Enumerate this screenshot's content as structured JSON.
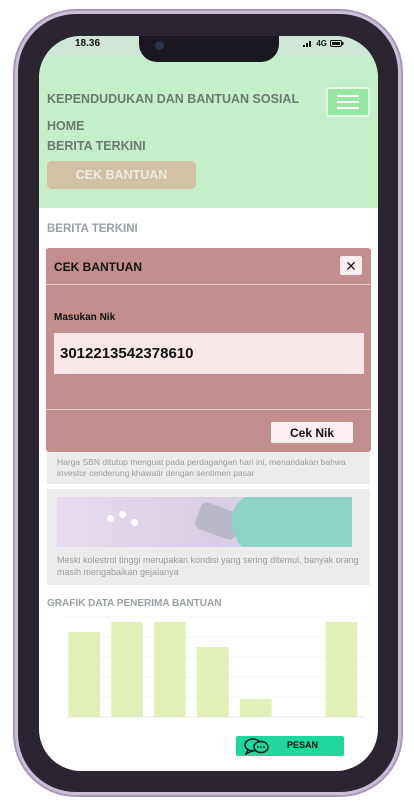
{
  "status_bar": {
    "time": "18.36",
    "network": "4G"
  },
  "header": {
    "brand": "KEPENDUDUKAN DAN BANTUAN SOSIAL",
    "nav": {
      "home": "HOME",
      "berita": "BERITA TERKINI",
      "cek": "CEK BANTUAN"
    }
  },
  "main": {
    "section_title": "BERITA TERKINI",
    "news": [
      {
        "text": "Harga SBN ditutup menguat pada perdagangan hari ini, menandakan bahwa investor cenderung khawatir dengan sentimen pasar"
      },
      {
        "text": "Meski kolestrol tinggi merupakan kondisi yang sering ditemui, banyak orang masih mengabaikan gejalanya"
      }
    ],
    "chart_title": "GRAFIK DATA PENERIMA BANTUAN"
  },
  "modal": {
    "title": "CEK BANTUAN",
    "close_icon": "close-icon",
    "label": "Masukan Nik",
    "nik_value": "3012213542378610",
    "button": "Cek Nik"
  },
  "pesan": {
    "label": "PESAN",
    "icon": "chat-icon"
  },
  "colors": {
    "header_bg": "#c5efc9",
    "modal_bg": "#c38e8e",
    "pesan_bg": "#1fd69c",
    "bar": "#e2f0b8"
  },
  "chart_data": {
    "type": "bar",
    "categories": [
      "",
      "",
      "",
      "",
      "",
      "",
      ""
    ],
    "values": [
      85,
      95,
      95,
      70,
      18,
      0,
      95
    ],
    "ylim": [
      0,
      100
    ],
    "grid": true
  }
}
